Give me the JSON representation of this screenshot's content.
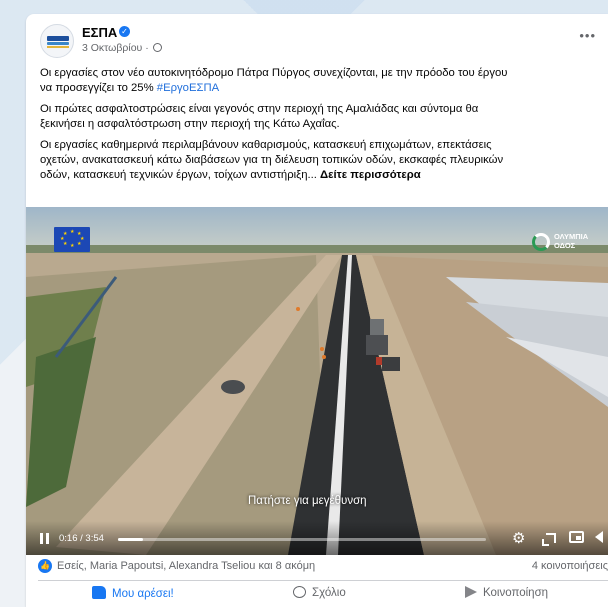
{
  "post": {
    "page_name": "ΕΣΠΑ",
    "date": "3 Οκτωβρίου ·",
    "paragraph1_line1": "Οι εργασίες στον νέο αυτοκινητόδρομο Πάτρα Πύργος συνεχίζονται, με την πρόοδο του έργου",
    "paragraph1_line2_text": "να προσεγγίζει το 25% ",
    "hashtag": "#ΕργοΕΣΠΑ",
    "paragraph2_line1": "Οι πρώτες ασφαλτοστρώσεις είναι γεγονός στην περιοχή της Αμαλιάδας και σύντομα θα",
    "paragraph2_line2": "ξεκινήσει η ασφαλτόστρωση στην περιοχή της Κάτω Αχαΐας.",
    "paragraph3_line1": "Οι εργασίες καθημερινά περιλαμβάνουν καθαρισμούς, κατασκευή επιχωμάτων, επεκτάσεις",
    "paragraph3_line2": "οχετών, ανακατασκευή κάτω διαβάσεων για τη διέλευση τοπικών οδών, εκσκαφές πλευρικών",
    "paragraph3_line3": "οδών, κατασκευή τεχνικών έργων, τοίχων αντιστήριξη... ",
    "see_more": "Δείτε περισσότερα"
  },
  "video": {
    "overlay_caption": "Πατήστε για μεγέθυνση",
    "time": "0:16 / 3:54",
    "progress_fraction": 0.068,
    "logo_line1": "ΟΛΥΜΠΙΑ",
    "logo_line2": "ΟΔΟΣ",
    "accent_color": "#1877f2"
  },
  "engagement": {
    "reactors": "Εσείς, Maria Papoutsi, Alexandra Tseliou και 8 ακόμη",
    "shares": "4 κοινοποιήσεις"
  },
  "actions": {
    "like": "Μου αρέσει!",
    "comment": "Σχόλιο",
    "share": "Κοινοποίηση"
  }
}
